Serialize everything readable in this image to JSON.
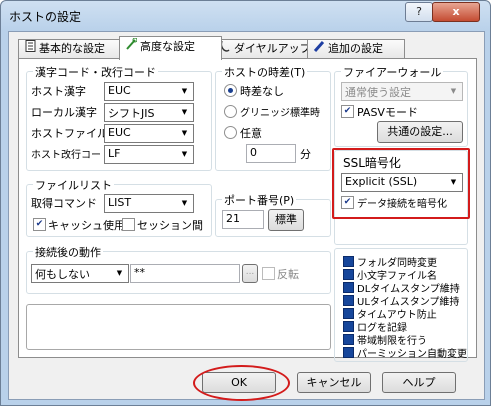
{
  "window": {
    "title": "ホストの設定",
    "help": "?",
    "close": "x"
  },
  "tabs": [
    {
      "label": "基本的な設定",
      "icon": "document-icon"
    },
    {
      "label": "高度な設定",
      "icon": "wrench-icon"
    },
    {
      "label": "ダイヤルアップ",
      "icon": "phone-icon"
    },
    {
      "label": "追加の設定",
      "icon": "pencil-icon"
    }
  ],
  "kanji": {
    "legend": "漢字コード・改行コード",
    "host_kanji_label": "ホスト漢字",
    "host_kanji_value": "EUC",
    "local_kanji_label": "ローカル漢字",
    "local_kanji_value": "シフトJIS",
    "host_file_label": "ホストファイル名",
    "host_file_value": "EUC",
    "host_newline_label": "ホスト改行コード",
    "host_newline_value": "LF"
  },
  "timediff": {
    "legend": "ホストの時差(T)",
    "none": "時差なし",
    "greenwich": "グリニッジ標準時",
    "any": "任意",
    "value": "0",
    "unit": "分"
  },
  "firewall": {
    "legend": "ファイアーウォール",
    "mode": "通常使う設定",
    "pasv": "PASVモード",
    "common_button": "共通の設定..."
  },
  "ssl": {
    "legend": "SSL暗号化",
    "mode": "Explicit (SSL)",
    "encrypt": "データ接続を暗号化"
  },
  "filelist": {
    "legend": "ファイルリスト",
    "command_label": "取得コマンド",
    "command_value": "LIST",
    "cache": "キャッシュ使用",
    "session": "セッション間"
  },
  "port": {
    "legend": "ポート番号(P)",
    "value": "21",
    "standard": "標準"
  },
  "after": {
    "legend": "接続後の動作",
    "action": "何もしない",
    "path": "**",
    "browse": "...",
    "reverse": "反転"
  },
  "options": [
    "フォルダ同時変更",
    "小文字ファイル名",
    "DLタイムスタンプ維持",
    "ULタイムスタンプ維持",
    "タイムアウト防止",
    "ログを記録",
    "帯域制限を行う",
    "パーミッション自動変更"
  ],
  "buttons": {
    "ok": "OK",
    "cancel": "キャンセル",
    "help": "ヘルプ"
  },
  "colors": {
    "highlight": "#d31b1b",
    "check_blue": "#16469b"
  }
}
